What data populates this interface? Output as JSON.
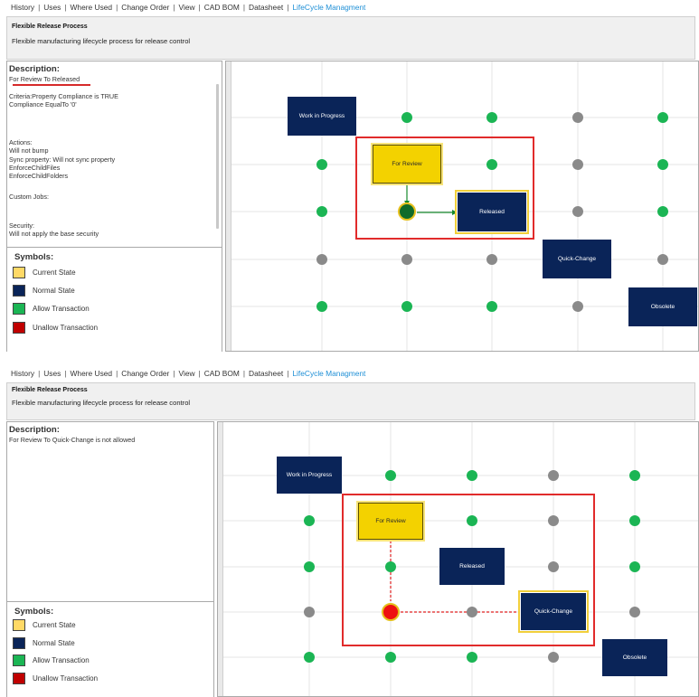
{
  "menu": [
    "History",
    "Uses",
    "Where Used",
    "Change Order",
    "View",
    "CAD BOM",
    "Datasheet",
    "LifeCycle Managment"
  ],
  "process": {
    "title": "Flexible Release Process",
    "description": "Flexible manufacturing lifecycle process for release control"
  },
  "states": {
    "work_in_progress": "Work in Progress",
    "for_review": "For Review",
    "released": "Released",
    "quick_change": "Quick-Change",
    "obsolete": "Obsolete"
  },
  "symbols": {
    "title": "Symbols:",
    "items": [
      {
        "label": "Current State",
        "color": "#ffd966"
      },
      {
        "label": "Normal State",
        "color": "#0a2458"
      },
      {
        "label": "Allow Transaction",
        "color": "#1bb554"
      },
      {
        "label": "Unallow Transaction",
        "color": "#c00000"
      }
    ]
  },
  "colors": {
    "allow": "#1bb554",
    "gray_node": "#8a8a8a",
    "unallow": "#ee1111",
    "highlight": "#e12b2b",
    "active_tab": "#1e8fd6"
  },
  "panel1": {
    "description_title": "Description:",
    "transition": "For Review To Released",
    "criteria": "Criteria:Property Compliance is TRUE\nCompliance EqualTo '0'",
    "actions": "Actions:\nWill not bump\nSync property: Will not sync property\nEnforceChildFiles\nEnforceChildFolders",
    "custom_jobs": "Custom Jobs:",
    "security": "Security:\nWill not apply the base security"
  },
  "panel2": {
    "description_title": "Description:",
    "transition": "For Review To Quick-Change is not allowed"
  }
}
